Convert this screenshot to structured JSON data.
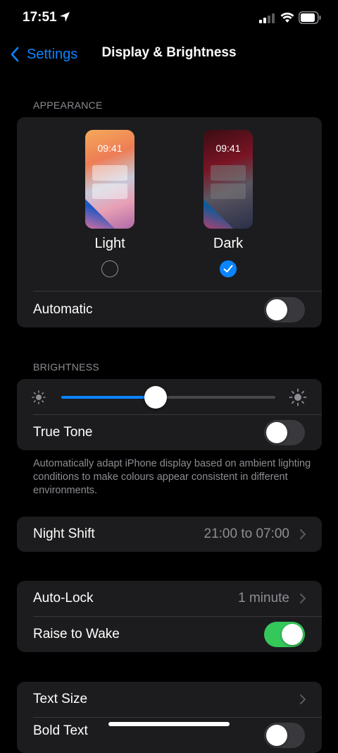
{
  "status_bar": {
    "time": "17:51"
  },
  "nav": {
    "back_label": "Settings",
    "title": "Display & Brightness"
  },
  "appearance": {
    "header": "APPEARANCE",
    "light": {
      "preview_time": "09:41",
      "label": "Light",
      "selected": false
    },
    "dark": {
      "preview_time": "09:41",
      "label": "Dark",
      "selected": true
    },
    "automatic": {
      "label": "Automatic",
      "on": false
    }
  },
  "brightness": {
    "header": "BRIGHTNESS",
    "level": 0.44,
    "true_tone": {
      "label": "True Tone",
      "on": false
    },
    "footnote": "Automatically adapt iPhone display based on ambient lighting conditions to make colours appear consistent in different environments."
  },
  "night_shift": {
    "label": "Night Shift",
    "value": "21:00 to 07:00"
  },
  "lock": {
    "auto_lock": {
      "label": "Auto-Lock",
      "value": "1 minute"
    },
    "raise_to_wake": {
      "label": "Raise to Wake",
      "on": true
    }
  },
  "text": {
    "text_size": {
      "label": "Text Size"
    },
    "bold_text": {
      "label": "Bold Text",
      "on": false
    }
  },
  "colors": {
    "accent": "#0a84ff",
    "toggle_on": "#34c759",
    "card": "#1c1c1e",
    "secondary_text": "#8d8d93"
  }
}
